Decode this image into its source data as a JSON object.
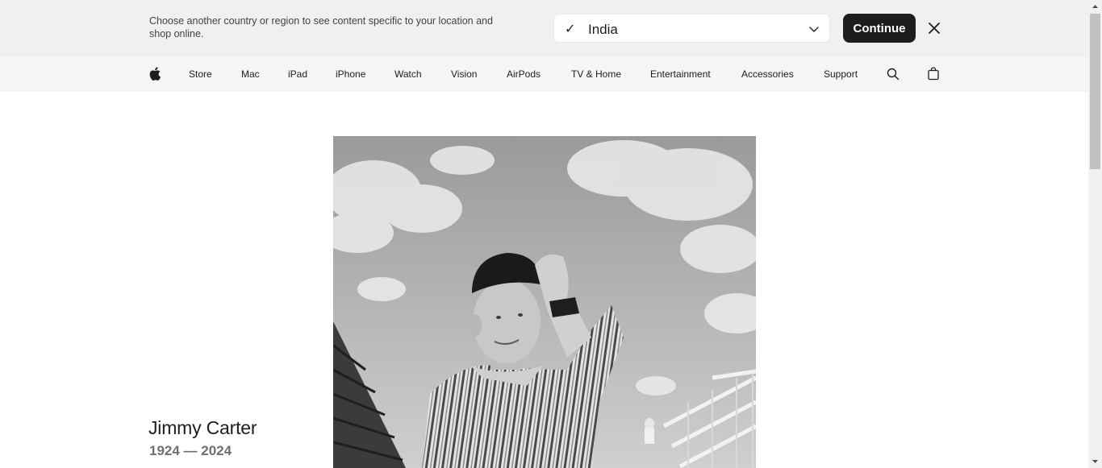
{
  "locale_banner": {
    "message": "Choose another country or region to see content specific to your location and shop online.",
    "selected_region": "India",
    "check_glyph": "✓",
    "continue_label": "Continue",
    "icons": {
      "check": "check-icon",
      "dropdown": "chevron-down-icon",
      "close": "close-icon"
    }
  },
  "nav": {
    "items": [
      {
        "label": "Store"
      },
      {
        "label": "Mac"
      },
      {
        "label": "iPad"
      },
      {
        "label": "iPhone"
      },
      {
        "label": "Watch"
      },
      {
        "label": "Vision"
      },
      {
        "label": "AirPods"
      },
      {
        "label": "TV & Home"
      },
      {
        "label": "Entertainment"
      },
      {
        "label": "Accessories"
      },
      {
        "label": "Support"
      }
    ],
    "icons": {
      "logo": "apple-logo-icon",
      "search": "search-icon",
      "bag": "shopping-bag-icon"
    }
  },
  "memorial": {
    "name": "Jimmy Carter",
    "years": "1924 — 2024"
  },
  "colors": {
    "banner_bg": "#f0f0f0",
    "nav_bg": "#f5f5f7",
    "text": "#1d1d1f",
    "secondary_text": "#6e6e73",
    "button_bg": "#1d1d1f"
  }
}
